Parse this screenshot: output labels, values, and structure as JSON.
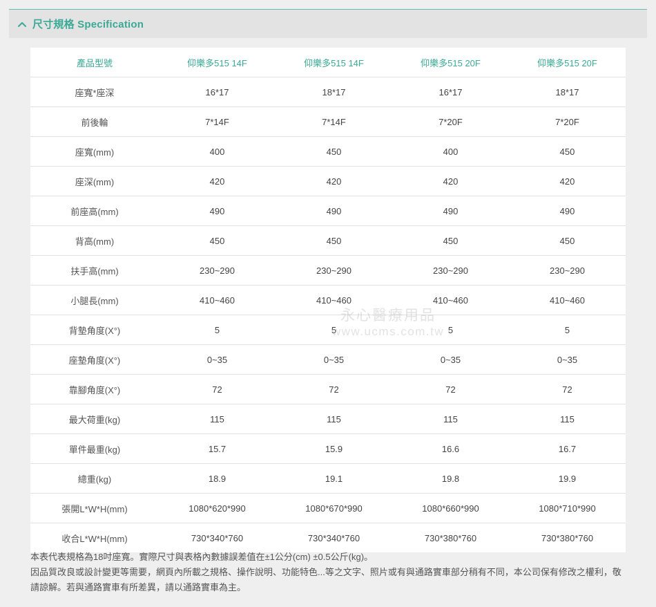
{
  "header": {
    "title": "尺寸規格 Specification",
    "accent_color": "#3aa996",
    "toggle_icon": "chevron-up-icon"
  },
  "table": {
    "columns": [
      "產品型號",
      "仰樂多515 14F",
      "仰樂多515 14F",
      "仰樂多515 20F",
      "仰樂多515 20F"
    ],
    "rows": [
      [
        "座寬*座深",
        "16*17",
        "18*17",
        "16*17",
        "18*17"
      ],
      [
        "前後輪",
        "7*14F",
        "7*14F",
        "7*20F",
        "7*20F"
      ],
      [
        "座寬(mm)",
        "400",
        "450",
        "400",
        "450"
      ],
      [
        "座深(mm)",
        "420",
        "420",
        "420",
        "420"
      ],
      [
        "前座高(mm)",
        "490",
        "490",
        "490",
        "490"
      ],
      [
        "背高(mm)",
        "450",
        "450",
        "450",
        "450"
      ],
      [
        "扶手高(mm)",
        "230~290",
        "230~290",
        "230~290",
        "230~290"
      ],
      [
        "小腿長(mm)",
        "410~460",
        "410~460",
        "410~460",
        "410~460"
      ],
      [
        "背墊角度(X°)",
        "5",
        "5",
        "5",
        "5"
      ],
      [
        "座墊角度(X°)",
        "0~35",
        "0~35",
        "0~35",
        "0~35"
      ],
      [
        "靠腳角度(X°)",
        "72",
        "72",
        "72",
        "72"
      ],
      [
        "最大荷重(kg)",
        "115",
        "115",
        "115",
        "115"
      ],
      [
        "單件最重(kg)",
        "15.7",
        "15.9",
        "16.6",
        "16.7"
      ],
      [
        "總重(kg)",
        "18.9",
        "19.1",
        "19.8",
        "19.9"
      ],
      [
        "張開L*W*H(mm)",
        "1080*620*990",
        "1080*670*990",
        "1080*660*990",
        "1080*710*990"
      ],
      [
        "收合L*W*H(mm)",
        "730*340*760",
        "730*340*760",
        "730*380*760",
        "730*380*760"
      ]
    ]
  },
  "watermark": {
    "line1": "永心醫療用品",
    "line2": "www.ucms.com.tw"
  },
  "notes": {
    "line1": "本表代表規格為18吋座寬。實際尺寸與表格內數據誤差值在±1公分(cm) ±0.5公斤(kg)。",
    "line2": "因品質改良或設計變更等需要，網頁內所載之規格、操作說明、功能特色...等之文字、照片或有與通路實車部分稍有不同，本公司保有修改之權利，敬請諒解。若與通路實車有所差異，請以通路實車為主。"
  }
}
